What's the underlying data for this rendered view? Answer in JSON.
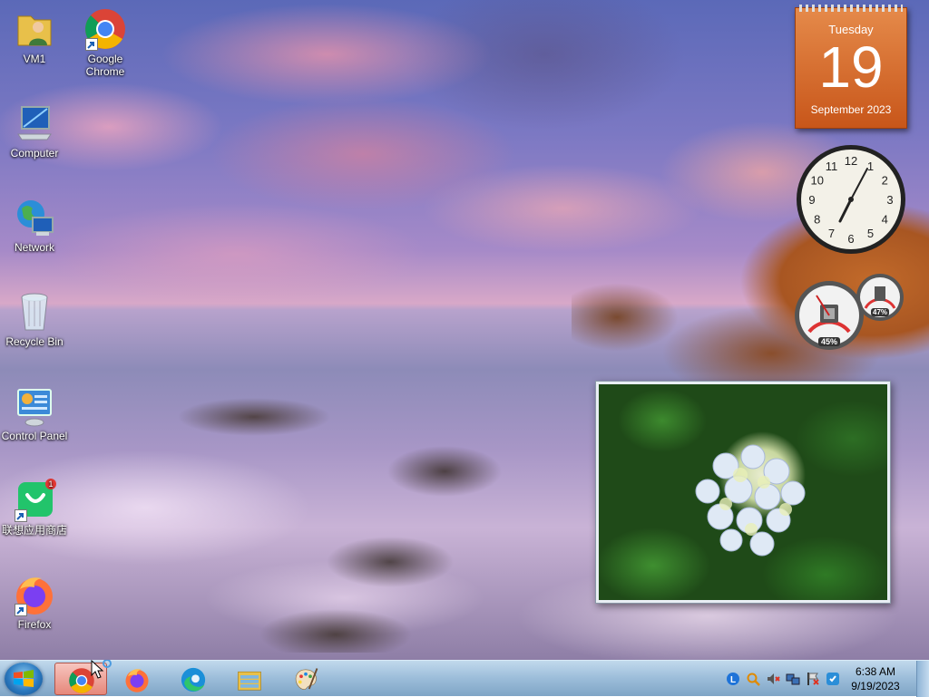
{
  "desktop": {
    "icons": [
      {
        "label": "VM1"
      },
      {
        "label": "Google Chrome"
      },
      {
        "label": "Computer"
      },
      {
        "label": "Network"
      },
      {
        "label": "Recycle Bin"
      },
      {
        "label": "Control Panel"
      },
      {
        "label": "联想应用商店",
        "badge": "1"
      },
      {
        "label": "Firefox"
      }
    ]
  },
  "gadgets": {
    "calendar": {
      "day_of_week": "Tuesday",
      "day": "19",
      "month_year": "September 2023"
    },
    "clock": {
      "numerals": [
        "12",
        "1",
        "2",
        "3",
        "4",
        "5",
        "6",
        "7",
        "8",
        "9",
        "10",
        "11"
      ]
    },
    "cpu_meter": {
      "cpu_percent": "45%",
      "memory_percent": "47%"
    }
  },
  "taskbar": {
    "apps": [
      "chrome",
      "firefox",
      "edge",
      "file-explorer",
      "paint"
    ],
    "tray": {
      "time": "6:38 AM",
      "date": "9/19/2023"
    }
  },
  "colors": {
    "calendar": "#d06a2a",
    "taskbar": "#9fc2e0"
  }
}
